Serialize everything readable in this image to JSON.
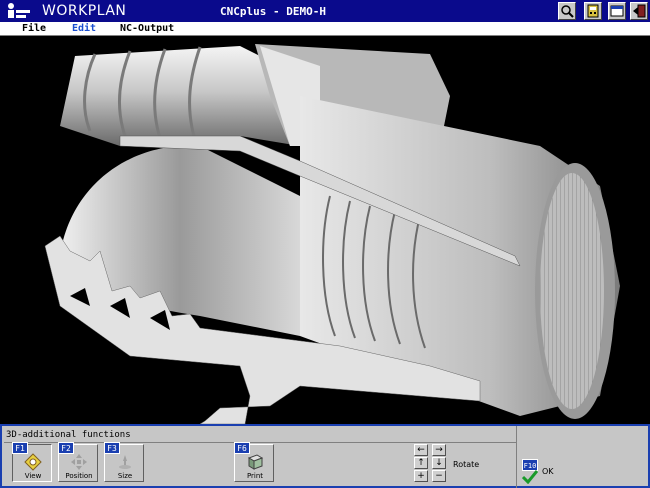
{
  "titlebar": {
    "app_name": "WORKPLAN",
    "window_title": "CNCplus - DEMO-H",
    "buttons": [
      "magnifier-icon",
      "calculator-icon",
      "window-icon",
      "exit-icon"
    ]
  },
  "menu": {
    "items": [
      {
        "label": "File",
        "active": false
      },
      {
        "label": "Edit",
        "active": true
      },
      {
        "label": "NC-Output",
        "active": false
      }
    ]
  },
  "viewport": {
    "content": "3d-sectioned-turned-part"
  },
  "panel": {
    "title": "3D-additional functions",
    "fkeys": [
      {
        "key": "F1",
        "label": "View",
        "icon": "view-icon",
        "pressed": true
      },
      {
        "key": "F2",
        "label": "Position",
        "icon": "position-icon",
        "pressed": false
      },
      {
        "key": "F3",
        "label": "Size",
        "icon": "size-icon",
        "pressed": false
      },
      {
        "key": "F6",
        "label": "Print",
        "icon": "print-icon",
        "pressed": false
      }
    ],
    "rotate_label": "Rotate",
    "arrows": [
      "←",
      "→",
      "↑",
      "↓",
      "+",
      "−"
    ],
    "ok": {
      "key": "F10",
      "label": "OK"
    }
  },
  "colors": {
    "title_bg": "#0a0a8c",
    "panel_border": "#1a3fb0",
    "active_menu": "#1a4fd0",
    "ok_check": "#1a9a2a"
  }
}
